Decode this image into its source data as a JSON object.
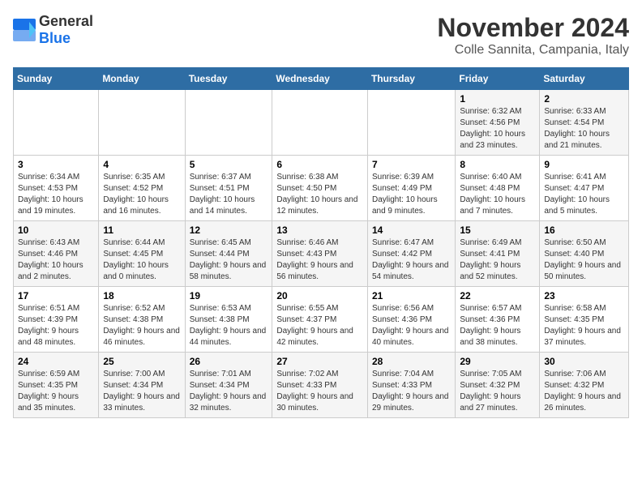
{
  "logo": {
    "text_general": "General",
    "text_blue": "Blue"
  },
  "title": "November 2024",
  "subtitle": "Colle Sannita, Campania, Italy",
  "days_of_week": [
    "Sunday",
    "Monday",
    "Tuesday",
    "Wednesday",
    "Thursday",
    "Friday",
    "Saturday"
  ],
  "weeks": [
    [
      {
        "day": "",
        "info": ""
      },
      {
        "day": "",
        "info": ""
      },
      {
        "day": "",
        "info": ""
      },
      {
        "day": "",
        "info": ""
      },
      {
        "day": "",
        "info": ""
      },
      {
        "day": "1",
        "info": "Sunrise: 6:32 AM\nSunset: 4:56 PM\nDaylight: 10 hours and 23 minutes."
      },
      {
        "day": "2",
        "info": "Sunrise: 6:33 AM\nSunset: 4:54 PM\nDaylight: 10 hours and 21 minutes."
      }
    ],
    [
      {
        "day": "3",
        "info": "Sunrise: 6:34 AM\nSunset: 4:53 PM\nDaylight: 10 hours and 19 minutes."
      },
      {
        "day": "4",
        "info": "Sunrise: 6:35 AM\nSunset: 4:52 PM\nDaylight: 10 hours and 16 minutes."
      },
      {
        "day": "5",
        "info": "Sunrise: 6:37 AM\nSunset: 4:51 PM\nDaylight: 10 hours and 14 minutes."
      },
      {
        "day": "6",
        "info": "Sunrise: 6:38 AM\nSunset: 4:50 PM\nDaylight: 10 hours and 12 minutes."
      },
      {
        "day": "7",
        "info": "Sunrise: 6:39 AM\nSunset: 4:49 PM\nDaylight: 10 hours and 9 minutes."
      },
      {
        "day": "8",
        "info": "Sunrise: 6:40 AM\nSunset: 4:48 PM\nDaylight: 10 hours and 7 minutes."
      },
      {
        "day": "9",
        "info": "Sunrise: 6:41 AM\nSunset: 4:47 PM\nDaylight: 10 hours and 5 minutes."
      }
    ],
    [
      {
        "day": "10",
        "info": "Sunrise: 6:43 AM\nSunset: 4:46 PM\nDaylight: 10 hours and 2 minutes."
      },
      {
        "day": "11",
        "info": "Sunrise: 6:44 AM\nSunset: 4:45 PM\nDaylight: 10 hours and 0 minutes."
      },
      {
        "day": "12",
        "info": "Sunrise: 6:45 AM\nSunset: 4:44 PM\nDaylight: 9 hours and 58 minutes."
      },
      {
        "day": "13",
        "info": "Sunrise: 6:46 AM\nSunset: 4:43 PM\nDaylight: 9 hours and 56 minutes."
      },
      {
        "day": "14",
        "info": "Sunrise: 6:47 AM\nSunset: 4:42 PM\nDaylight: 9 hours and 54 minutes."
      },
      {
        "day": "15",
        "info": "Sunrise: 6:49 AM\nSunset: 4:41 PM\nDaylight: 9 hours and 52 minutes."
      },
      {
        "day": "16",
        "info": "Sunrise: 6:50 AM\nSunset: 4:40 PM\nDaylight: 9 hours and 50 minutes."
      }
    ],
    [
      {
        "day": "17",
        "info": "Sunrise: 6:51 AM\nSunset: 4:39 PM\nDaylight: 9 hours and 48 minutes."
      },
      {
        "day": "18",
        "info": "Sunrise: 6:52 AM\nSunset: 4:38 PM\nDaylight: 9 hours and 46 minutes."
      },
      {
        "day": "19",
        "info": "Sunrise: 6:53 AM\nSunset: 4:38 PM\nDaylight: 9 hours and 44 minutes."
      },
      {
        "day": "20",
        "info": "Sunrise: 6:55 AM\nSunset: 4:37 PM\nDaylight: 9 hours and 42 minutes."
      },
      {
        "day": "21",
        "info": "Sunrise: 6:56 AM\nSunset: 4:36 PM\nDaylight: 9 hours and 40 minutes."
      },
      {
        "day": "22",
        "info": "Sunrise: 6:57 AM\nSunset: 4:36 PM\nDaylight: 9 hours and 38 minutes."
      },
      {
        "day": "23",
        "info": "Sunrise: 6:58 AM\nSunset: 4:35 PM\nDaylight: 9 hours and 37 minutes."
      }
    ],
    [
      {
        "day": "24",
        "info": "Sunrise: 6:59 AM\nSunset: 4:35 PM\nDaylight: 9 hours and 35 minutes."
      },
      {
        "day": "25",
        "info": "Sunrise: 7:00 AM\nSunset: 4:34 PM\nDaylight: 9 hours and 33 minutes."
      },
      {
        "day": "26",
        "info": "Sunrise: 7:01 AM\nSunset: 4:34 PM\nDaylight: 9 hours and 32 minutes."
      },
      {
        "day": "27",
        "info": "Sunrise: 7:02 AM\nSunset: 4:33 PM\nDaylight: 9 hours and 30 minutes."
      },
      {
        "day": "28",
        "info": "Sunrise: 7:04 AM\nSunset: 4:33 PM\nDaylight: 9 hours and 29 minutes."
      },
      {
        "day": "29",
        "info": "Sunrise: 7:05 AM\nSunset: 4:32 PM\nDaylight: 9 hours and 27 minutes."
      },
      {
        "day": "30",
        "info": "Sunrise: 7:06 AM\nSunset: 4:32 PM\nDaylight: 9 hours and 26 minutes."
      }
    ]
  ]
}
